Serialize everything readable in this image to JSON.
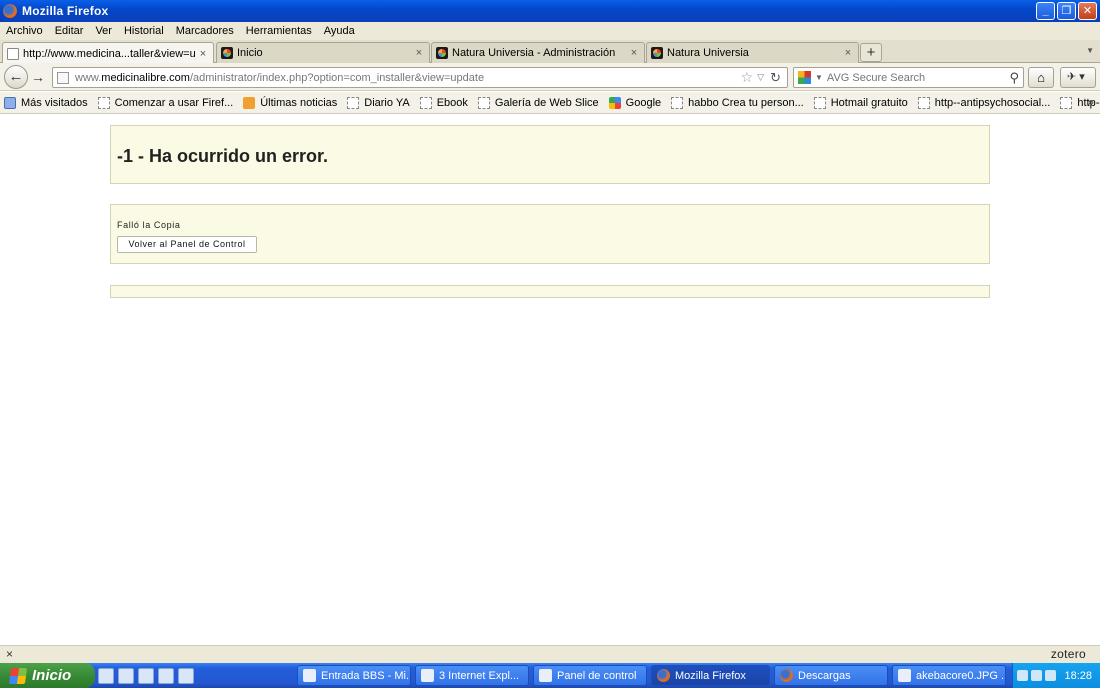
{
  "window": {
    "title": "Mozilla Firefox",
    "buttons": {
      "minimize": "_",
      "restore": "❐",
      "close": "✕"
    }
  },
  "menubar": [
    "Archivo",
    "Editar",
    "Ver",
    "Historial",
    "Marcadores",
    "Herramientas",
    "Ayuda"
  ],
  "tabs": [
    {
      "label": "http://www.medicina...taller&view=update",
      "active": true,
      "icon": "blank-page-icon"
    },
    {
      "label": "Inicio",
      "active": false,
      "icon": "joomla-icon"
    },
    {
      "label": "Natura Universia - Administración",
      "active": false,
      "icon": "joomla-icon"
    },
    {
      "label": "Natura Universia",
      "active": false,
      "icon": "joomla-icon"
    }
  ],
  "tab_close": "×",
  "new_tab": "+",
  "nav": {
    "back": "←",
    "forward": "→",
    "url_prefix": "www.",
    "url_domain": "medicinalibre.com",
    "url_path": "/administrator/index.php?option=com_installer&view=update",
    "search_placeholder": "AVG Secure Search",
    "home": "⌂"
  },
  "bookmarks": [
    {
      "label": "Más visitados",
      "icon": "most-visited-icon"
    },
    {
      "label": "Comenzar a usar Firef...",
      "icon": "bookmark-page-icon"
    },
    {
      "label": "Últimas noticias",
      "icon": "rss-icon"
    },
    {
      "label": "Diario YA",
      "icon": "bookmark-page-icon"
    },
    {
      "label": "Ebook",
      "icon": "bookmark-page-icon"
    },
    {
      "label": "Galería de Web Slice",
      "icon": "bookmark-page-icon"
    },
    {
      "label": "Google",
      "icon": "google-icon"
    },
    {
      "label": "habbo Crea tu person...",
      "icon": "bookmark-page-icon"
    },
    {
      "label": "Hotmail gratuito",
      "icon": "bookmark-page-icon"
    },
    {
      "label": "http--antipsychosocial...",
      "icon": "bookmark-page-icon"
    },
    {
      "label": "http--cache.lego.com-...",
      "icon": "bookmark-page-icon"
    }
  ],
  "bookmarks_more": "»",
  "page": {
    "error_title": "-1 - Ha ocurrido un error.",
    "message": "Falló la Copia",
    "back_button": "Volver al Panel de Control"
  },
  "addonbar": {
    "close": "×",
    "zotero": "zotero"
  },
  "taskbar": {
    "start": "Inicio",
    "tasks": [
      {
        "label": "Entrada BBS - Mi...",
        "active": false
      },
      {
        "label": "3 Internet Expl...",
        "active": false
      },
      {
        "label": "Panel de control",
        "active": false
      },
      {
        "label": "Mozilla Firefox",
        "active": true
      },
      {
        "label": "Descargas",
        "active": false
      },
      {
        "label": "akebacore0.JPG ...",
        "active": false
      }
    ],
    "clock": "18:28"
  },
  "colors": {
    "error_box_bg": "#fbfbe5",
    "error_box_border": "#d4d3b4",
    "titlebar_blue": "#0348c9",
    "start_green": "#388a34"
  }
}
